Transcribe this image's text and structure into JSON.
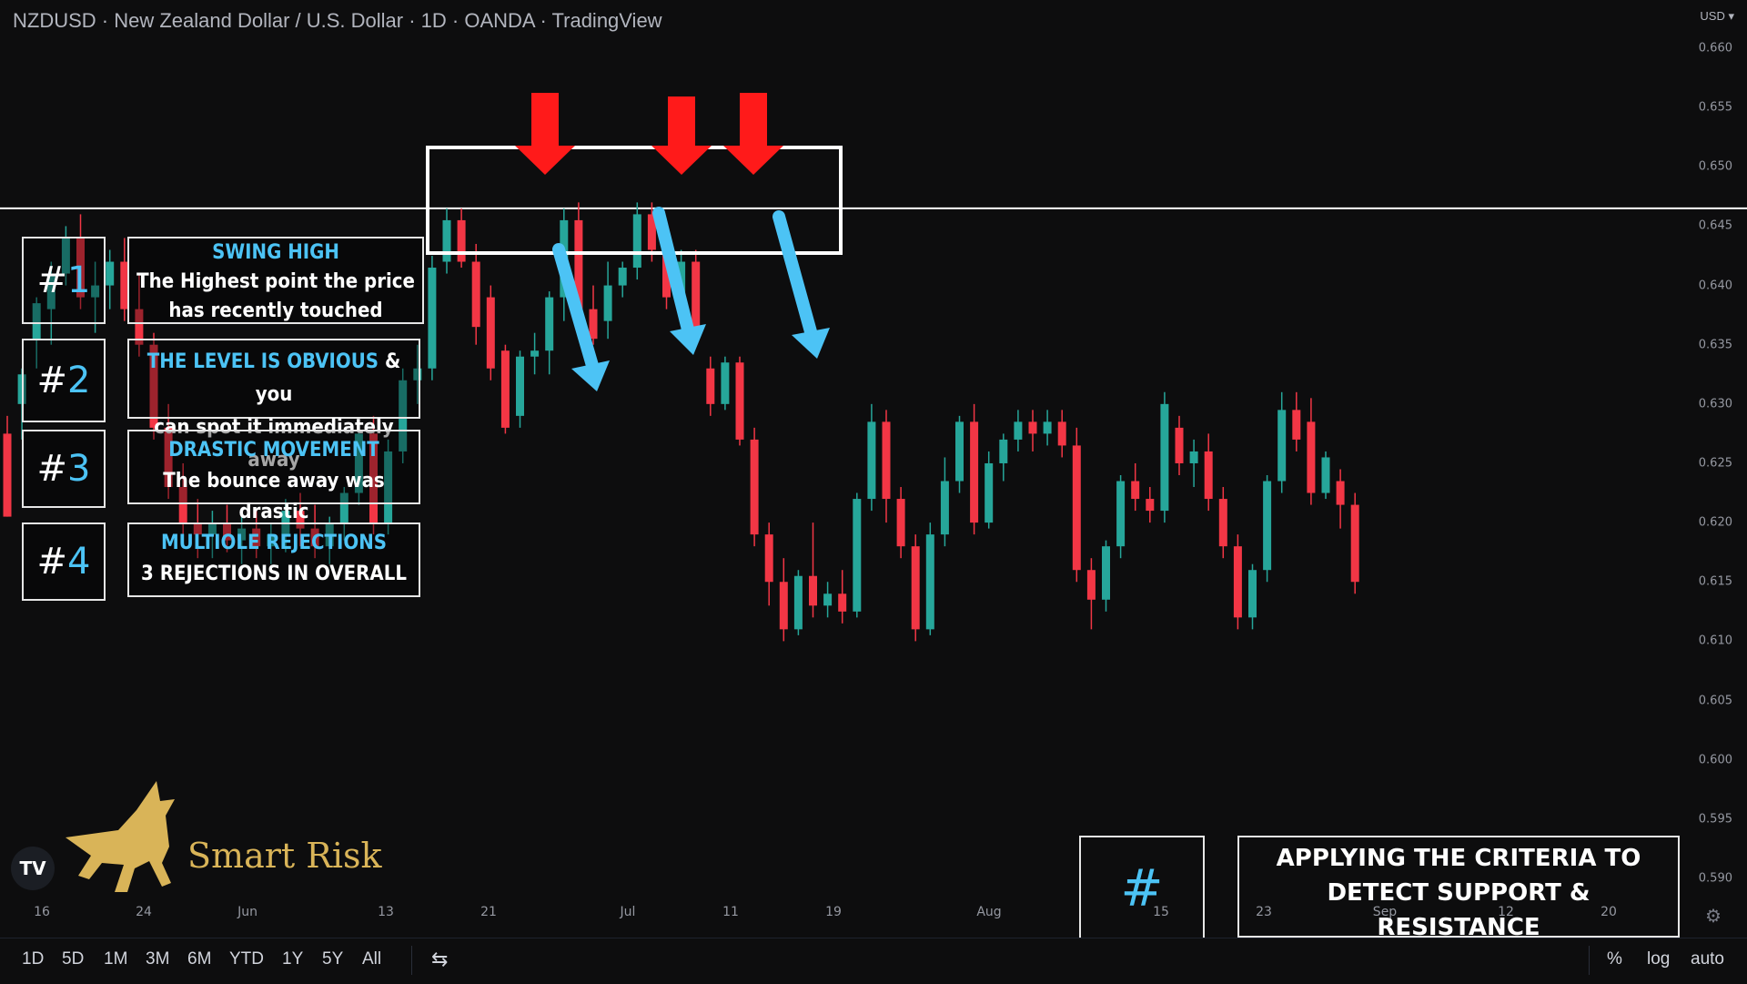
{
  "header": {
    "title": "NZDUSD · New Zealand Dollar / U.S. Dollar · 1D · OANDA · TradingView",
    "currency": "USD ▾"
  },
  "price_axis": [
    "0.660",
    "0.655",
    "0.650",
    "0.645",
    "0.640",
    "0.635",
    "0.630",
    "0.625",
    "0.620",
    "0.615",
    "0.610",
    "0.605",
    "0.600",
    "0.595",
    "0.590"
  ],
  "time_axis": [
    "16",
    "24",
    "Jun",
    "13",
    "21",
    "Jul",
    "11",
    "19",
    "Aug",
    "15",
    "23",
    "Sep",
    "12",
    "20"
  ],
  "bottom_toolbar": {
    "ranges": [
      "1D",
      "5D",
      "1M",
      "3M",
      "6M",
      "YTD",
      "1Y",
      "5Y",
      "All"
    ],
    "right": [
      "%",
      "log",
      "auto"
    ]
  },
  "overlay": {
    "criteria": [
      {
        "num": "1",
        "title": "SWING HIGH",
        "lines": [
          "The Highest point the price",
          "has recently touched"
        ]
      },
      {
        "num": "2",
        "title": "THE LEVEL IS OBVIOUS",
        "title_tail": " & you",
        "lines": [
          "can spot it immediately away"
        ]
      },
      {
        "num": "3",
        "title": "DRASTIC MOVEMENT",
        "lines": [
          "The bounce away was drastic"
        ]
      },
      {
        "num": "4",
        "title": "MULTIOLE REJECTIONS",
        "lines": [
          "3 REJECTIONS IN OVERALL"
        ]
      }
    ],
    "hash": "#",
    "bottom_caption": [
      "APPLYING THE CRITERIA TO",
      "DETECT SUPPORT &",
      "RESISTANCE"
    ],
    "brand": "Smart Risk",
    "tv_logo": "TV"
  },
  "colors": {
    "bull": "#26a69a",
    "bear": "#f23645",
    "accent_blue": "#4cc3f5",
    "arrow_red": "#ff1a1a",
    "brand_gold": "#d9b458"
  },
  "chart_data": {
    "type": "candlestick",
    "symbol": "NZDUSD",
    "interval": "1D",
    "ylim": [
      0.587,
      0.661
    ],
    "resistance_level": 0.6465,
    "candles": [
      {
        "o": 0.6275,
        "h": 0.629,
        "l": 0.6205,
        "c": 0.6205
      },
      {
        "o": 0.63,
        "h": 0.633,
        "l": 0.627,
        "c": 0.6325
      },
      {
        "o": 0.6355,
        "h": 0.639,
        "l": 0.633,
        "c": 0.6385
      },
      {
        "o": 0.638,
        "h": 0.642,
        "l": 0.635,
        "c": 0.641
      },
      {
        "o": 0.641,
        "h": 0.645,
        "l": 0.64,
        "c": 0.644
      },
      {
        "o": 0.644,
        "h": 0.646,
        "l": 0.638,
        "c": 0.639
      },
      {
        "o": 0.639,
        "h": 0.642,
        "l": 0.636,
        "c": 0.64
      },
      {
        "o": 0.64,
        "h": 0.643,
        "l": 0.638,
        "c": 0.642
      },
      {
        "o": 0.642,
        "h": 0.644,
        "l": 0.637,
        "c": 0.638
      },
      {
        "o": 0.638,
        "h": 0.641,
        "l": 0.634,
        "c": 0.635
      },
      {
        "o": 0.635,
        "h": 0.636,
        "l": 0.627,
        "c": 0.628
      },
      {
        "o": 0.628,
        "h": 0.63,
        "l": 0.622,
        "c": 0.623
      },
      {
        "o": 0.623,
        "h": 0.625,
        "l": 0.619,
        "c": 0.62
      },
      {
        "o": 0.62,
        "h": 0.622,
        "l": 0.617,
        "c": 0.619
      },
      {
        "o": 0.619,
        "h": 0.621,
        "l": 0.617,
        "c": 0.62
      },
      {
        "o": 0.62,
        "h": 0.6215,
        "l": 0.6175,
        "c": 0.6185
      },
      {
        "o": 0.6185,
        "h": 0.6205,
        "l": 0.6165,
        "c": 0.6195
      },
      {
        "o": 0.6195,
        "h": 0.621,
        "l": 0.617,
        "c": 0.618
      },
      {
        "o": 0.618,
        "h": 0.62,
        "l": 0.6165,
        "c": 0.619
      },
      {
        "o": 0.619,
        "h": 0.622,
        "l": 0.6175,
        "c": 0.621
      },
      {
        "o": 0.621,
        "h": 0.6225,
        "l": 0.618,
        "c": 0.6195
      },
      {
        "o": 0.6195,
        "h": 0.6215,
        "l": 0.617,
        "c": 0.618
      },
      {
        "o": 0.618,
        "h": 0.6205,
        "l": 0.6165,
        "c": 0.62
      },
      {
        "o": 0.62,
        "h": 0.623,
        "l": 0.6185,
        "c": 0.6225
      },
      {
        "o": 0.6225,
        "h": 0.6285,
        "l": 0.6215,
        "c": 0.6275
      },
      {
        "o": 0.6275,
        "h": 0.629,
        "l": 0.619,
        "c": 0.62
      },
      {
        "o": 0.62,
        "h": 0.627,
        "l": 0.619,
        "c": 0.626
      },
      {
        "o": 0.626,
        "h": 0.633,
        "l": 0.625,
        "c": 0.632
      },
      {
        "o": 0.632,
        "h": 0.635,
        "l": 0.63,
        "c": 0.633
      },
      {
        "o": 0.633,
        "h": 0.6425,
        "l": 0.632,
        "c": 0.6415
      },
      {
        "o": 0.642,
        "h": 0.6465,
        "l": 0.641,
        "c": 0.6455
      },
      {
        "o": 0.6455,
        "h": 0.6465,
        "l": 0.6415,
        "c": 0.642
      },
      {
        "o": 0.642,
        "h": 0.6435,
        "l": 0.635,
        "c": 0.6365
      },
      {
        "o": 0.639,
        "h": 0.64,
        "l": 0.632,
        "c": 0.633
      },
      {
        "o": 0.6345,
        "h": 0.635,
        "l": 0.6275,
        "c": 0.628
      },
      {
        "o": 0.629,
        "h": 0.6345,
        "l": 0.628,
        "c": 0.634
      },
      {
        "o": 0.634,
        "h": 0.636,
        "l": 0.6325,
        "c": 0.6345
      },
      {
        "o": 0.6345,
        "h": 0.6395,
        "l": 0.6325,
        "c": 0.639
      },
      {
        "o": 0.639,
        "h": 0.6465,
        "l": 0.637,
        "c": 0.6455
      },
      {
        "o": 0.6455,
        "h": 0.647,
        "l": 0.637,
        "c": 0.638
      },
      {
        "o": 0.638,
        "h": 0.64,
        "l": 0.635,
        "c": 0.6355
      },
      {
        "o": 0.637,
        "h": 0.642,
        "l": 0.6355,
        "c": 0.64
      },
      {
        "o": 0.64,
        "h": 0.642,
        "l": 0.639,
        "c": 0.6415
      },
      {
        "o": 0.6415,
        "h": 0.647,
        "l": 0.6405,
        "c": 0.646
      },
      {
        "o": 0.646,
        "h": 0.647,
        "l": 0.642,
        "c": 0.643
      },
      {
        "o": 0.643,
        "h": 0.645,
        "l": 0.638,
        "c": 0.639
      },
      {
        "o": 0.639,
        "h": 0.643,
        "l": 0.638,
        "c": 0.642
      },
      {
        "o": 0.642,
        "h": 0.643,
        "l": 0.635,
        "c": 0.636
      },
      {
        "o": 0.633,
        "h": 0.634,
        "l": 0.629,
        "c": 0.63
      },
      {
        "o": 0.63,
        "h": 0.634,
        "l": 0.6295,
        "c": 0.6335
      },
      {
        "o": 0.6335,
        "h": 0.634,
        "l": 0.6265,
        "c": 0.627
      },
      {
        "o": 0.627,
        "h": 0.628,
        "l": 0.618,
        "c": 0.619
      },
      {
        "o": 0.619,
        "h": 0.62,
        "l": 0.613,
        "c": 0.615
      },
      {
        "o": 0.615,
        "h": 0.617,
        "l": 0.61,
        "c": 0.611
      },
      {
        "o": 0.611,
        "h": 0.616,
        "l": 0.6105,
        "c": 0.6155
      },
      {
        "o": 0.6155,
        "h": 0.62,
        "l": 0.612,
        "c": 0.613
      },
      {
        "o": 0.613,
        "h": 0.615,
        "l": 0.612,
        "c": 0.614
      },
      {
        "o": 0.614,
        "h": 0.616,
        "l": 0.6115,
        "c": 0.6125
      },
      {
        "o": 0.6125,
        "h": 0.6225,
        "l": 0.612,
        "c": 0.622
      },
      {
        "o": 0.622,
        "h": 0.63,
        "l": 0.621,
        "c": 0.6285
      },
      {
        "o": 0.6285,
        "h": 0.6295,
        "l": 0.62,
        "c": 0.622
      },
      {
        "o": 0.622,
        "h": 0.623,
        "l": 0.617,
        "c": 0.618
      },
      {
        "o": 0.618,
        "h": 0.619,
        "l": 0.61,
        "c": 0.611
      },
      {
        "o": 0.611,
        "h": 0.62,
        "l": 0.6105,
        "c": 0.619
      },
      {
        "o": 0.619,
        "h": 0.6255,
        "l": 0.618,
        "c": 0.6235
      },
      {
        "o": 0.6235,
        "h": 0.629,
        "l": 0.6225,
        "c": 0.6285
      },
      {
        "o": 0.6285,
        "h": 0.63,
        "l": 0.619,
        "c": 0.62
      },
      {
        "o": 0.62,
        "h": 0.626,
        "l": 0.6195,
        "c": 0.625
      },
      {
        "o": 0.625,
        "h": 0.6275,
        "l": 0.6235,
        "c": 0.627
      },
      {
        "o": 0.627,
        "h": 0.6295,
        "l": 0.626,
        "c": 0.6285
      },
      {
        "o": 0.6285,
        "h": 0.6295,
        "l": 0.626,
        "c": 0.6275
      },
      {
        "o": 0.6275,
        "h": 0.6295,
        "l": 0.6265,
        "c": 0.6285
      },
      {
        "o": 0.6285,
        "h": 0.6295,
        "l": 0.6255,
        "c": 0.6265
      },
      {
        "o": 0.6265,
        "h": 0.628,
        "l": 0.615,
        "c": 0.616
      },
      {
        "o": 0.616,
        "h": 0.617,
        "l": 0.611,
        "c": 0.6135
      },
      {
        "o": 0.6135,
        "h": 0.6185,
        "l": 0.6125,
        "c": 0.618
      },
      {
        "o": 0.618,
        "h": 0.624,
        "l": 0.617,
        "c": 0.6235
      },
      {
        "o": 0.6235,
        "h": 0.625,
        "l": 0.621,
        "c": 0.622
      },
      {
        "o": 0.622,
        "h": 0.623,
        "l": 0.62,
        "c": 0.621
      },
      {
        "o": 0.621,
        "h": 0.631,
        "l": 0.62,
        "c": 0.63
      },
      {
        "o": 0.628,
        "h": 0.629,
        "l": 0.624,
        "c": 0.625
      },
      {
        "o": 0.625,
        "h": 0.627,
        "l": 0.623,
        "c": 0.626
      },
      {
        "o": 0.626,
        "h": 0.6275,
        "l": 0.621,
        "c": 0.622
      },
      {
        "o": 0.622,
        "h": 0.623,
        "l": 0.617,
        "c": 0.618
      },
      {
        "o": 0.618,
        "h": 0.619,
        "l": 0.611,
        "c": 0.612
      },
      {
        "o": 0.612,
        "h": 0.6165,
        "l": 0.611,
        "c": 0.616
      },
      {
        "o": 0.616,
        "h": 0.624,
        "l": 0.615,
        "c": 0.6235
      },
      {
        "o": 0.6235,
        "h": 0.631,
        "l": 0.6225,
        "c": 0.6295
      },
      {
        "o": 0.6295,
        "h": 0.631,
        "l": 0.626,
        "c": 0.627
      },
      {
        "o": 0.6285,
        "h": 0.6305,
        "l": 0.6215,
        "c": 0.6225
      },
      {
        "o": 0.6225,
        "h": 0.626,
        "l": 0.622,
        "c": 0.6255
      },
      {
        "o": 0.6235,
        "h": 0.6245,
        "l": 0.6195,
        "c": 0.6215
      },
      {
        "o": 0.6215,
        "h": 0.6225,
        "l": 0.614,
        "c": 0.615
      }
    ]
  }
}
